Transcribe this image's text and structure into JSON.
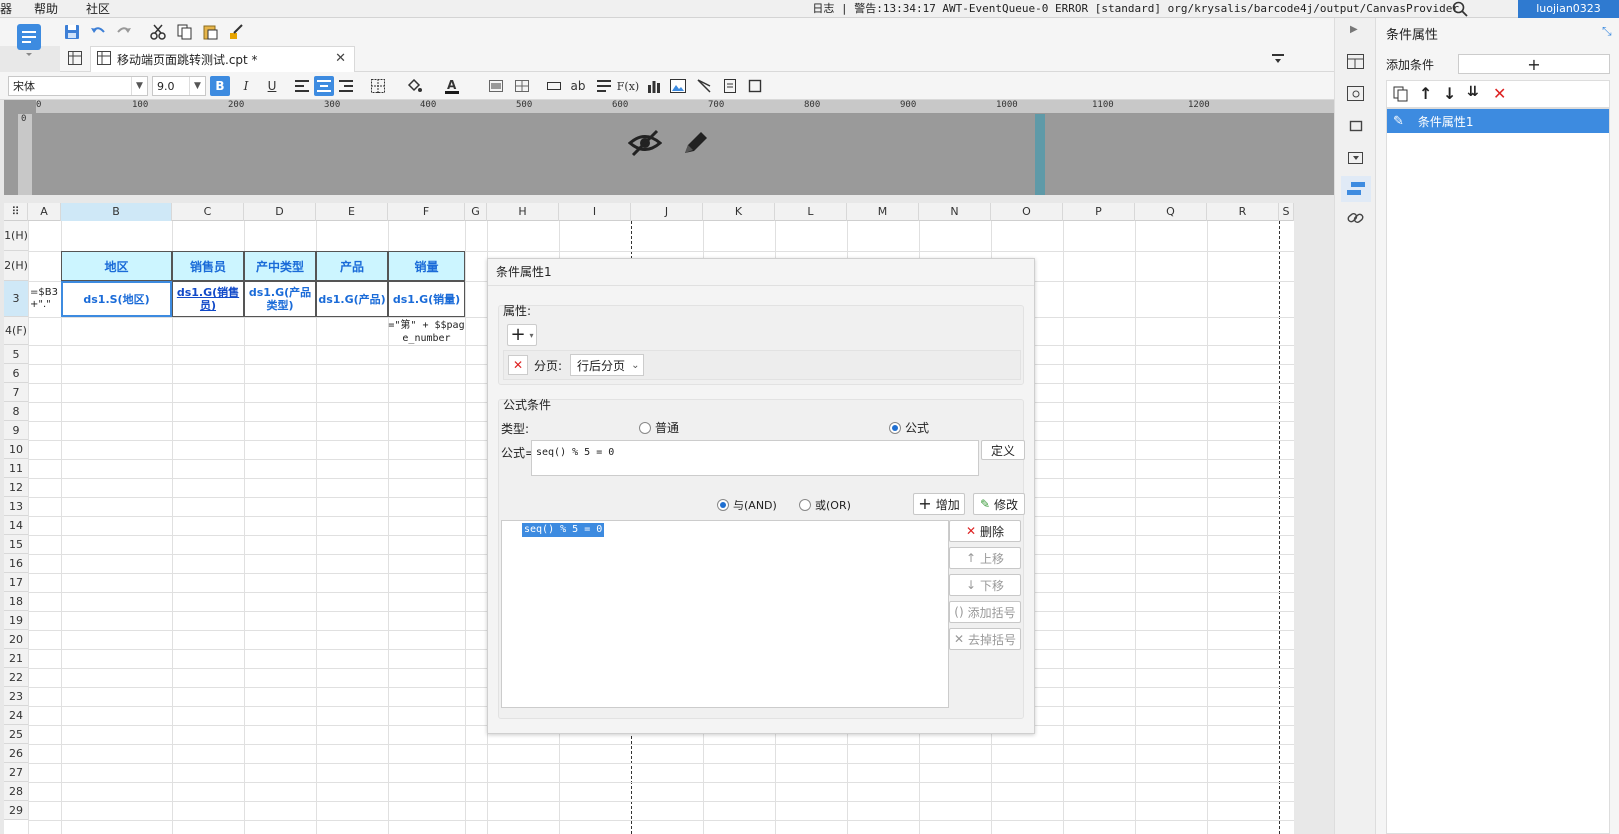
{
  "menu": {
    "items": [
      "器",
      "帮助",
      "社区"
    ]
  },
  "log": {
    "text": "日志 | 警告:13:34:17 AWT-EventQueue-0 ERROR [standard] org/krysalis/barcode4j/output/CanvasProvider"
  },
  "user": {
    "name": "luojian0323"
  },
  "tab": {
    "title": "移动端页面跳转测试.cpt *"
  },
  "format": {
    "font": "宋体",
    "size": "9.0",
    "bold": "B",
    "italic": "I",
    "underline": "U",
    "ab": "ab",
    "fx": "F(x)"
  },
  "ruler": {
    "h_ticks": [
      "0",
      "100",
      "200",
      "300",
      "400",
      "500",
      "600",
      "700",
      "800",
      "900",
      "1000",
      "1100",
      "1200"
    ],
    "v_tick": "0"
  },
  "grid": {
    "columns": [
      "A",
      "B",
      "C",
      "D",
      "E",
      "F",
      "G",
      "H",
      "I",
      "J",
      "K",
      "L",
      "M",
      "N",
      "O",
      "P",
      "Q",
      "R",
      "S"
    ],
    "rows": [
      "1(H)",
      "2(H)",
      "3",
      "4(F)",
      "5",
      "6",
      "7",
      "8",
      "9",
      "10",
      "11",
      "12",
      "13",
      "14",
      "15",
      "16",
      "17",
      "18",
      "19",
      "20",
      "21",
      "22",
      "23",
      "24",
      "25",
      "26",
      "27",
      "28",
      "29"
    ],
    "headers": [
      "地区",
      "销售员",
      "产中类型",
      "产品",
      "销量"
    ],
    "data": [
      "ds1.S(地区)",
      "ds1.G(销售员)",
      "ds1.G(产品类型)",
      "ds1.G(产品)",
      "ds1.G(销量)"
    ],
    "a3": "=$B3+\".\"",
    "f4": "=\"第\" + $$page_number"
  },
  "dialog": {
    "title": "条件属性1",
    "attr_label": "属性:",
    "page_label": "分页:",
    "page_value": "行后分页",
    "formula_group": "公式条件",
    "type_label": "类型:",
    "type_normal": "普通",
    "type_formula": "公式",
    "formula_label": "公式=",
    "formula_value": "seq() % 5 = 0",
    "define_btn": "定义",
    "and_label": "与(AND)",
    "or_label": "或(OR)",
    "add_btn": "增加",
    "modify_btn": "修改",
    "list_item": "seq() % 5 = 0",
    "delete_btn": "删除",
    "up_btn": "上移",
    "down_btn": "下移",
    "add_paren_btn": "添加括号",
    "remove_paren_btn": "去掉括号"
  },
  "panel": {
    "title": "条件属性",
    "add_label": "添加条件",
    "item": "条件属性1"
  }
}
